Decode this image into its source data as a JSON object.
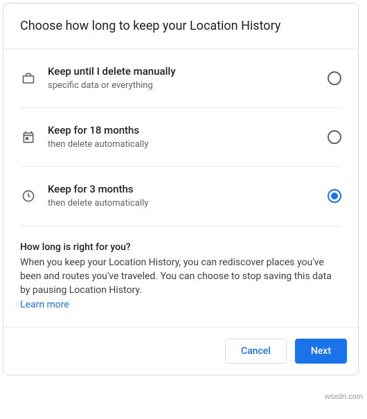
{
  "header": {
    "title": "Choose how long to keep your Location History"
  },
  "options": [
    {
      "icon": "briefcase-icon",
      "title": "Keep until I delete manually",
      "sub": "specific data or everything",
      "selected": false
    },
    {
      "icon": "calendar-icon",
      "title": "Keep for 18 months",
      "sub": "then delete automatically",
      "selected": false
    },
    {
      "icon": "clock-icon",
      "title": "Keep for 3 months",
      "sub": "then delete automatically",
      "selected": true
    }
  ],
  "info": {
    "title": "How long is right for you?",
    "body": "When you keep your Location History, you can rediscover places you've been and routes you've traveled. You can choose to stop saving this data by pausing Location History.",
    "learn_more": "Learn more"
  },
  "footer": {
    "cancel": "Cancel",
    "next": "Next"
  },
  "watermark": "wsxdn.com"
}
